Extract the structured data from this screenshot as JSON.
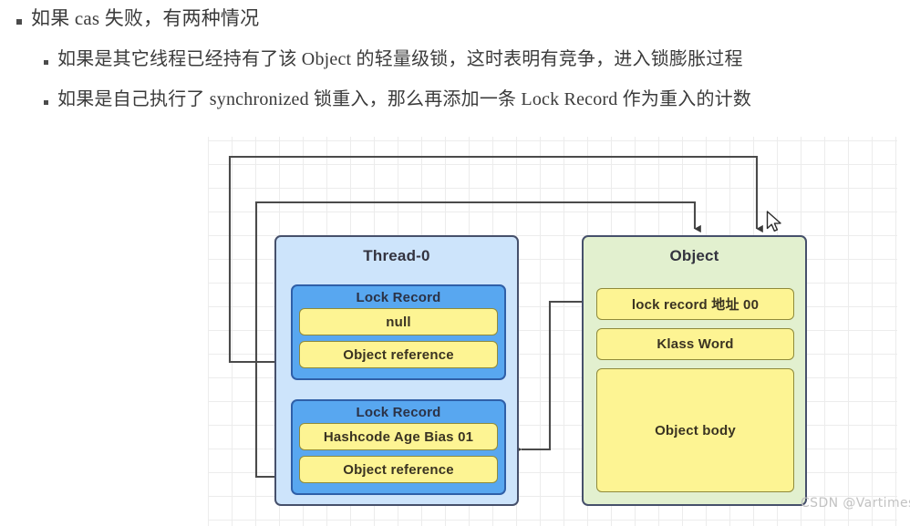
{
  "notes": [
    {
      "level": 1,
      "bullet": "square-bullet",
      "text": "如果 cas 失败，有两种情况"
    },
    {
      "level": 2,
      "bullet": "square-bullet",
      "text": "如果是其它线程已经持有了该 Object 的轻量级锁，这时表明有竞争，进入锁膨胀过程"
    },
    {
      "level": 2,
      "bullet": "square-bullet",
      "text": "如果是自己执行了 synchronized 锁重入，那么再添加一条 Lock Record 作为重入的计数"
    }
  ],
  "diagram": {
    "thread": {
      "title": "Thread-0",
      "lock_records": [
        {
          "title": "Lock Record",
          "fields": [
            "null",
            "Object reference"
          ]
        },
        {
          "title": "Lock Record",
          "fields": [
            "Hashcode Age Bias 01",
            "Object reference"
          ]
        }
      ]
    },
    "object": {
      "title": "Object",
      "fields": [
        "lock record 地址 00",
        "Klass Word",
        "Object body"
      ]
    },
    "colors": {
      "thread_fill": "#cde4fb",
      "object_fill": "#e2f0cf",
      "lock_record_fill": "#58a7f0",
      "field_fill": "#fdf493",
      "border": "#46506b",
      "connector": "#4a4a4a",
      "grid": "#ececec"
    }
  },
  "watermark": {
    "text": "CSDN @Vartimes"
  },
  "cursor": {
    "name": "mouse-pointer"
  }
}
